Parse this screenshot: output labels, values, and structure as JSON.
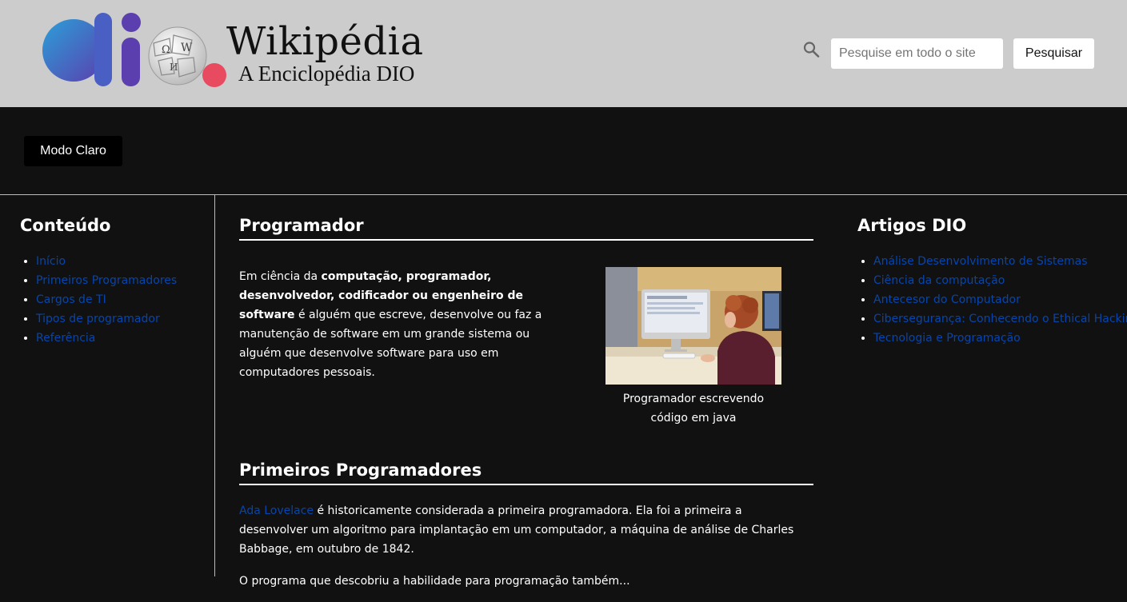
{
  "header": {
    "brand_title": "Wikipédia",
    "brand_subtitle": "A Enciclopédia DIO",
    "search_placeholder": "Pesquise em todo o site",
    "search_button": "Pesquisar"
  },
  "mode_button": "Modo Claro",
  "sidebar": {
    "title": "Conteúdo",
    "items": [
      {
        "label": "Início"
      },
      {
        "label": "Primeiros Programadores"
      },
      {
        "label": "Cargos de TI"
      },
      {
        "label": "Tipos de programador"
      },
      {
        "label": "Referência"
      }
    ]
  },
  "main": {
    "section1_title": "Programador",
    "intro_prefix": "Em ciência da ",
    "intro_bold": "computação, programador, desenvolvedor, codificador ou engenheiro de software",
    "intro_rest": " é alguém que escreve, desenvolve ou faz a manutenção de software em um grande sistema ou alguém que desenvolve software para uso em computadores pessoais.",
    "figure_caption": "Programador escrevendo código em java",
    "section2_title": "Primeiros Programadores",
    "para2_link": "Ada Lovelace",
    "para2_rest": " é historicamente considerada a primeira programadora. Ela foi a primeira a desenvolver um algoritmo para implantação em um computador, a máquina de análise de Charles Babbage, em outubro de 1842.",
    "para3_partial": "O programa que descobriu a habilidade para programação também..."
  },
  "artigos": {
    "title": "Artigos DIO",
    "items": [
      {
        "label": "Análise Desenvolvimento de Sistemas"
      },
      {
        "label": "Ciência da computação"
      },
      {
        "label": "Antecesor do Computador"
      },
      {
        "label": "Cibersegurança: Conhecendo o Ethical Hacking"
      },
      {
        "label": "Tecnologia e Programação"
      }
    ]
  },
  "colors": {
    "header_bg": "#cccccc",
    "page_bg": "#111111",
    "link": "#0645ad",
    "logo_gradient_start": "#2b9fd8",
    "logo_gradient_end": "#5b3fae",
    "logo_dot": "#e84a5f"
  },
  "icons": {
    "search": "search-icon",
    "logo": "dio-wikipedia-logo"
  }
}
